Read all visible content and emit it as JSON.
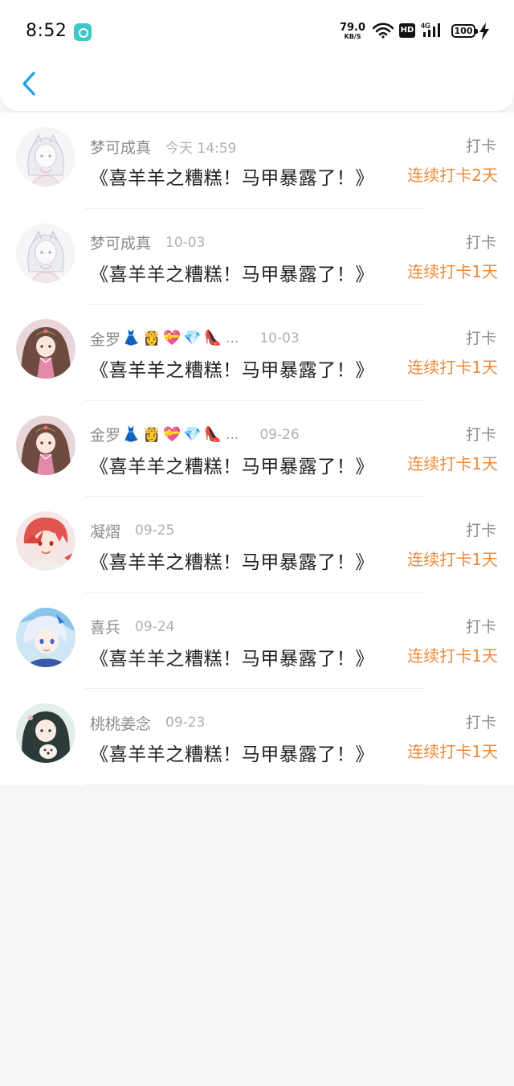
{
  "status_bar": {
    "time": "8:52",
    "net_speed_value": "79.0",
    "net_speed_unit": "KB/S",
    "hd": "HD",
    "battery": "100",
    "network": "4G"
  },
  "nav": {
    "back_icon": "chevron-left-icon"
  },
  "colors": {
    "accent": "#2b9fe6",
    "streak": "#ee8a3c",
    "muted": "#8c8c8c",
    "time": "#b0b0b0"
  },
  "records": [
    {
      "name": "梦可成真",
      "badges": [],
      "ellipsis": "",
      "time": "今天 14:59",
      "title": "《喜羊羊之糟糕！马甲暴露了！》",
      "action": "打卡",
      "streak": "连续打卡2天",
      "avatar": "sketch-girl"
    },
    {
      "name": "梦可成真",
      "badges": [],
      "ellipsis": "",
      "time": "10-03",
      "title": "《喜羊羊之糟糕！马甲暴露了！》",
      "action": "打卡",
      "streak": "连续打卡1天",
      "avatar": "sketch-girl"
    },
    {
      "name": "金罗",
      "badges": [
        "👗",
        "👸",
        "💝",
        "💎",
        "👠"
      ],
      "ellipsis": "...",
      "time": "10-03",
      "title": "《喜羊羊之糟糕！马甲暴露了！》",
      "action": "打卡",
      "streak": "连续打卡1天",
      "avatar": "princess"
    },
    {
      "name": "金罗",
      "badges": [
        "👗",
        "👸",
        "💝",
        "💎",
        "👠"
      ],
      "ellipsis": "...",
      "time": "09-26",
      "title": "《喜羊羊之糟糕！马甲暴露了！》",
      "action": "打卡",
      "streak": "连续打卡1天",
      "avatar": "princess"
    },
    {
      "name": "凝熠",
      "badges": [],
      "ellipsis": "",
      "time": "09-25",
      "title": "《喜羊羊之糟糕！马甲暴露了！》",
      "action": "打卡",
      "streak": "连续打卡1天",
      "avatar": "red-hair-boy"
    },
    {
      "name": "喜兵",
      "badges": [],
      "ellipsis": "",
      "time": "09-24",
      "title": "《喜羊羊之糟糕！马甲暴露了！》",
      "action": "打卡",
      "streak": "连续打卡1天",
      "avatar": "blue-hair-boy"
    },
    {
      "name": "桃桃姜念",
      "badges": [],
      "ellipsis": "",
      "time": "09-23",
      "title": "《喜羊羊之糟糕！马甲暴露了！》",
      "action": "打卡",
      "streak": "连续打卡1天",
      "avatar": "dark-hair-girl"
    }
  ]
}
